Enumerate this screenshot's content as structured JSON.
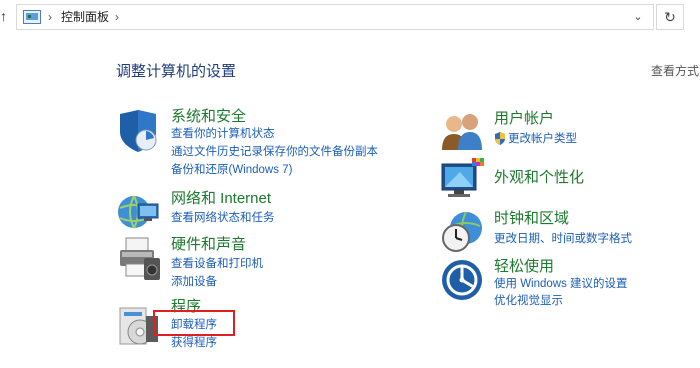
{
  "address": {
    "crumb": "控制面板",
    "sep1": "›",
    "sep2": "›",
    "dropdown_glyph": "⌄",
    "refresh_glyph": "↻",
    "up_glyph": "↑"
  },
  "page_title": "调整计算机的设置",
  "view_by": "查看方式",
  "left": [
    {
      "title": "系统和安全",
      "links": [
        "查看你的计算机状态",
        "通过文件历史记录保存你的文件备份副本",
        "备份和还原(Windows 7)"
      ]
    },
    {
      "title": "网络和 Internet",
      "links": [
        "查看网络状态和任务"
      ]
    },
    {
      "title": "硬件和声音",
      "links": [
        "查看设备和打印机",
        "添加设备"
      ]
    },
    {
      "title": "程序",
      "links": [
        "卸载程序",
        "获得程序"
      ]
    }
  ],
  "right": [
    {
      "title": "用户帐户",
      "links": [
        "更改帐户类型"
      ]
    },
    {
      "title": "外观和个性化",
      "links": []
    },
    {
      "title": "时钟和区域",
      "links": [
        "更改日期、时间或数字格式"
      ]
    },
    {
      "title": "轻松使用",
      "links": [
        "使用 Windows 建议的设置",
        "优化视觉显示"
      ]
    }
  ],
  "colors": {
    "title_green": "#1d7a2e",
    "link_blue": "#1d5fb8",
    "heading_blue": "#1f3d7a",
    "highlight_red": "#e02020"
  }
}
